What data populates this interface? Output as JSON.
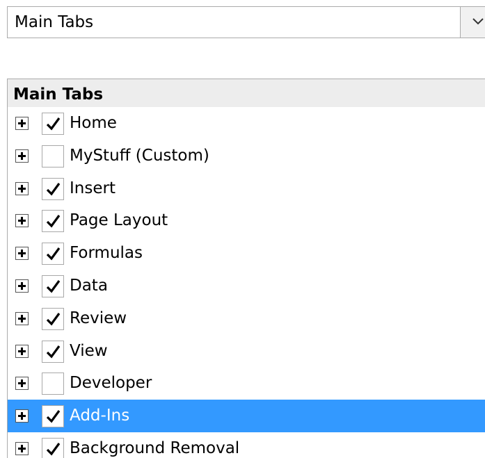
{
  "dropdown": {
    "value": "Main Tabs",
    "arrow_icon": "chevron-down-icon"
  },
  "tree": {
    "header": "Main Tabs",
    "expand_icon": "plus-icon",
    "check_icon": "checkmark-icon",
    "selected_color": "#3399ff",
    "items": [
      {
        "label": "Home",
        "checked": true,
        "selected": false
      },
      {
        "label": "MyStuff (Custom)",
        "checked": false,
        "selected": false
      },
      {
        "label": "Insert",
        "checked": true,
        "selected": false
      },
      {
        "label": "Page Layout",
        "checked": true,
        "selected": false
      },
      {
        "label": "Formulas",
        "checked": true,
        "selected": false
      },
      {
        "label": "Data",
        "checked": true,
        "selected": false
      },
      {
        "label": "Review",
        "checked": true,
        "selected": false
      },
      {
        "label": "View",
        "checked": true,
        "selected": false
      },
      {
        "label": "Developer",
        "checked": false,
        "selected": false
      },
      {
        "label": "Add-Ins",
        "checked": true,
        "selected": true
      },
      {
        "label": "Background Removal",
        "checked": true,
        "selected": false
      }
    ]
  }
}
